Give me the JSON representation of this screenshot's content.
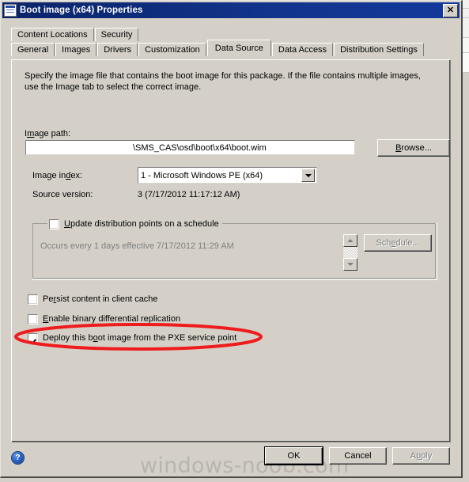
{
  "window": {
    "title": "Boot image (x64) Properties",
    "icon": "properties-window-icon",
    "close_label": "✕"
  },
  "tabs": {
    "row1": [
      {
        "label": "Content Locations",
        "selected": false
      },
      {
        "label": "Security",
        "selected": false
      }
    ],
    "row2": [
      {
        "label": "General",
        "selected": false
      },
      {
        "label": "Images",
        "selected": false
      },
      {
        "label": "Drivers",
        "selected": false
      },
      {
        "label": "Customization",
        "selected": false
      },
      {
        "label": "Data Source",
        "selected": true
      },
      {
        "label": "Data Access",
        "selected": false
      },
      {
        "label": "Distribution Settings",
        "selected": false
      }
    ]
  },
  "page": {
    "description": "Specify the image file that contains the boot image for this package. If the file contains multiple images, use the Image tab to select the correct image.",
    "image_path": {
      "label": "Image path:",
      "label_prefix": "I",
      "label_accel": "m",
      "label_suffix": "age path:",
      "value": "\\SMS_CAS\\osd\\boot\\x64\\boot.wim",
      "browse_label": "Browse...",
      "browse_prefix": "",
      "browse_accel": "B",
      "browse_suffix": "rowse..."
    },
    "image_index": {
      "label_prefix": "Image in",
      "label_accel": "d",
      "label_suffix": "ex:",
      "value": "1 - Microsoft Windows PE (x64)"
    },
    "source_version": {
      "label": "Source version:",
      "value": "3 (7/17/2012 11:17:12 AM)"
    },
    "schedule_group": {
      "checkbox_label_prefix": "",
      "checkbox_accel": "U",
      "checkbox_label_suffix": "pdate distribution points on a schedule",
      "checked": false,
      "occurs_text": "Occurs every 1 days effective 7/17/2012 11:29 AM",
      "button_prefix": "Sch",
      "button_accel": "e",
      "button_suffix": "dule...",
      "button_enabled": false
    },
    "checkboxes": [
      {
        "name": "persist-content-in-client-cache",
        "prefix": "Pe",
        "accel": "r",
        "suffix": "sist content in client cache",
        "checked": false
      },
      {
        "name": "enable-binary-differential-replication",
        "prefix": "",
        "accel": "E",
        "suffix": "nable binary differential replication",
        "checked": false
      },
      {
        "name": "deploy-boot-image-from-pxe-service-point",
        "prefix": "Deploy this b",
        "accel": "o",
        "suffix": "ot image from the PXE service point",
        "checked": true
      }
    ]
  },
  "annotation": {
    "type": "red-ellipse-highlight",
    "color": "#ee1c1c",
    "target": "deploy-boot-image-from-pxe-service-point"
  },
  "footer": {
    "help_label": "?",
    "watermark": "windows-noob.com",
    "ok_label": "OK",
    "cancel_label": "Cancel",
    "apply_prefix": "A",
    "apply_accel": "p",
    "apply_suffix": "ply",
    "apply_enabled": false
  },
  "colors": {
    "dialog_face": "#d4d0c8",
    "titlebar": "#0a246a",
    "annotation_red": "#ee1c1c",
    "disabled_text": "#808080",
    "watermark": "#b8b5ae"
  }
}
